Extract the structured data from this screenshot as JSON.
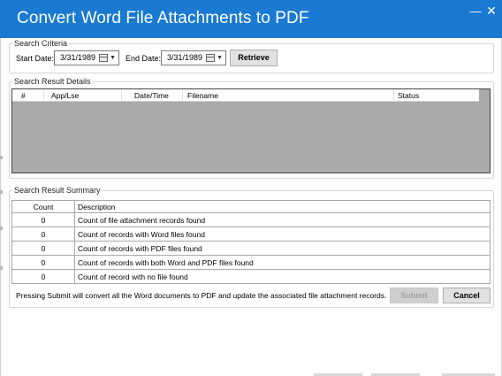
{
  "window": {
    "title": "Convert Word File Attachments to PDF",
    "minimize_glyph": "—",
    "close_glyph": "✕"
  },
  "search_criteria": {
    "group_label": "Search Criteria",
    "start_label": "Start Date:",
    "start_value": "3/31/1989",
    "end_label": "End Date:",
    "end_value": "3/31/1989",
    "retrieve_label": "Retrieve"
  },
  "results": {
    "group_label": "Search Result Details",
    "columns": [
      "#",
      "App/Lse",
      "Date/Time",
      "Filename",
      "Status"
    ]
  },
  "summary": {
    "group_label": "Search Result Summary",
    "header": {
      "count": "Count",
      "description": "Description"
    },
    "rows": [
      {
        "count": "0",
        "description": "Count of file attachment records found"
      },
      {
        "count": "0",
        "description": "Count of records with Word files found"
      },
      {
        "count": "0",
        "description": "Count of records with PDF files found"
      },
      {
        "count": "0",
        "description": "Count of records with both Word and PDF files found"
      },
      {
        "count": "0",
        "description": "Count of record with no file found"
      }
    ],
    "note": "Pressing Submit will convert all the Word documents to PDF and update the associated file attachment records.",
    "submit_label": "Submit",
    "cancel_label": "Cancel"
  },
  "colors": {
    "titlebar": "#1a7ad2",
    "grid_empty": "#aaaaaa"
  }
}
